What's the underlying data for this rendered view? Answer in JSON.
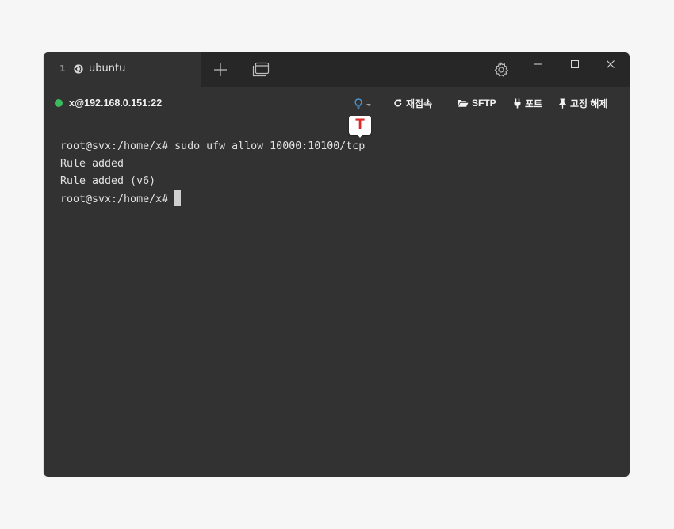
{
  "titlebar": {
    "tab": {
      "index": "1",
      "os_icon": "ubuntu-icon",
      "title": "ubuntu"
    },
    "buttons": [
      "new-tab-icon",
      "tab-list-icon",
      "gear-icon",
      "minimize-icon",
      "maximize-icon",
      "close-icon"
    ]
  },
  "infobar": {
    "host": "x@192.168.0.151:22",
    "status_color": "#3dba5f",
    "hint_icon": "lightbulb-icon",
    "actions": {
      "reconnect": "재접속",
      "sftp": "SFTP",
      "port": "포트",
      "unpin": "고정 해제"
    }
  },
  "badge": {
    "letter": "T",
    "color": "#d92b2b"
  },
  "terminal": {
    "lines": [
      "root@svx:/home/x# sudo ufw allow 10000:10100/tcp",
      "Rule added",
      "Rule added (v6)",
      "root@svx:/home/x#"
    ]
  }
}
